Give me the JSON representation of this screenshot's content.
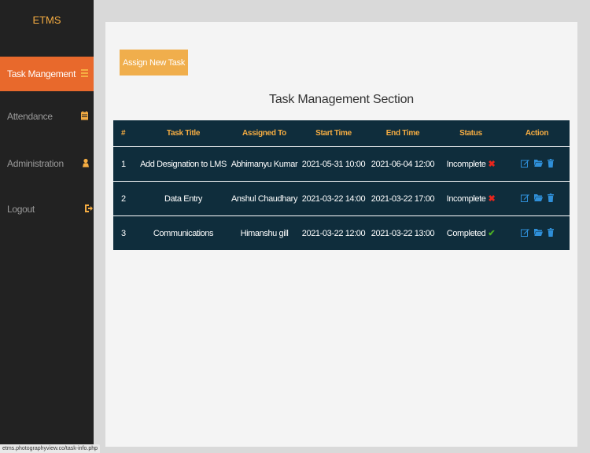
{
  "sidebar": {
    "brand": "ETMS",
    "items": [
      {
        "label": "Task Mangement",
        "icon": "list-icon",
        "active": true
      },
      {
        "label": "Attendance",
        "icon": "calendar-icon",
        "active": false
      },
      {
        "label": "Administration",
        "icon": "user-icon",
        "active": false
      },
      {
        "label": "Logout",
        "icon": "logout-icon",
        "active": false
      }
    ]
  },
  "main": {
    "assign_button": "Assign New Task",
    "section_title": "Task Management Section",
    "table": {
      "headers": [
        "#",
        "Task Title",
        "Assigned To",
        "Start Time",
        "End Time",
        "Status",
        "Action"
      ],
      "rows": [
        {
          "num": "1",
          "title": "Add Designation to LMS",
          "assigned": "Abhimanyu Kumar",
          "start": "2021-05-31 10:00",
          "end": "2021-06-04 12:00",
          "status": "Incomplete",
          "status_icon": "x-icon"
        },
        {
          "num": "2",
          "title": "Data Entry",
          "assigned": "Anshul Chaudhary",
          "start": "2021-03-22 14:00",
          "end": "2021-03-22 17:00",
          "status": "Incomplete",
          "status_icon": "x-icon"
        },
        {
          "num": "3",
          "title": "Communications",
          "assigned": "Himanshu gill",
          "start": "2021-03-22 12:00",
          "end": "2021-03-22 13:00",
          "status": "Completed",
          "status_icon": "check-icon"
        }
      ]
    }
  },
  "status_bar": {
    "url": "etms.photographyview.co/task-info.php"
  },
  "colors": {
    "sidebar_bg": "#222222",
    "active_item": "#e8692c",
    "accent": "#f6ad42",
    "table_bg": "#0f2d3c",
    "action_icons": "#2f8fd8"
  }
}
